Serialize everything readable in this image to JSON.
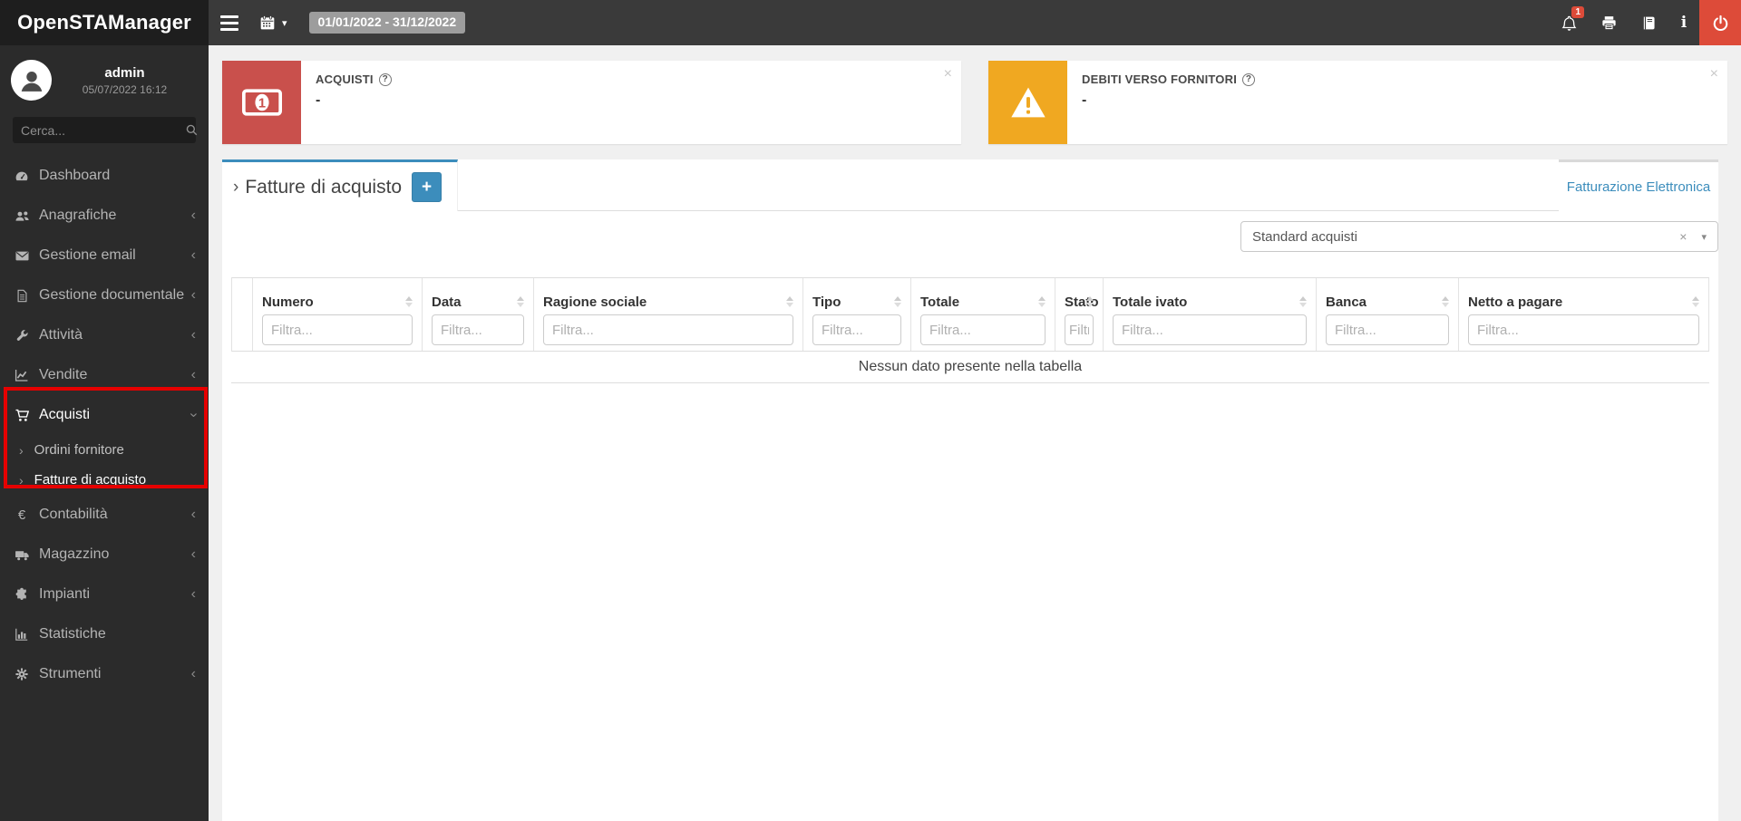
{
  "app": {
    "name": "OpenSTAManager"
  },
  "navbar": {
    "date_range": "01/01/2022 - 31/12/2022",
    "notification_count": "1"
  },
  "sidebar": {
    "user_name": "admin",
    "user_datetime": "05/07/2022 16:12",
    "search_placeholder": "Cerca...",
    "items": [
      {
        "label": "Dashboard"
      },
      {
        "label": "Anagrafiche"
      },
      {
        "label": "Gestione email"
      },
      {
        "label": "Gestione documentale"
      },
      {
        "label": "Attività"
      },
      {
        "label": "Vendite"
      },
      {
        "label": "Acquisti"
      },
      {
        "label": "Contabilità"
      },
      {
        "label": "Magazzino"
      },
      {
        "label": "Impianti"
      },
      {
        "label": "Statistiche"
      },
      {
        "label": "Strumenti"
      }
    ],
    "acquisti_children": [
      {
        "label": "Ordini fornitore"
      },
      {
        "label": "Fatture di acquisto"
      }
    ]
  },
  "widgets": [
    {
      "title": "ACQUISTI",
      "value": "-",
      "accent": "#c9504c"
    },
    {
      "title": "DEBITI VERSO FORNITORI",
      "value": "-",
      "accent": "#f0a821"
    }
  ],
  "tabs": {
    "active_title": "Fatture di acquisto",
    "add_label": "+",
    "right_link": "Fatturazione Elettronica"
  },
  "toolbar": {
    "view_select_value": "Standard acquisti"
  },
  "table": {
    "filter_placeholder": "Filtra...",
    "empty_message": "Nessun dato presente nella tabella",
    "columns": [
      {
        "label": "Numero"
      },
      {
        "label": "Data"
      },
      {
        "label": "Ragione sociale"
      },
      {
        "label": "Tipo"
      },
      {
        "label": "Totale"
      },
      {
        "label": "Stato"
      },
      {
        "label": "Totale ivato"
      },
      {
        "label": "Banca"
      },
      {
        "label": "Netto a pagare"
      }
    ]
  },
  "glyphs": {
    "help": "?",
    "close": "×",
    "clear": "×",
    "caret_down": "▾",
    "chevron_collapsed": "‹",
    "chevron_sub": "›",
    "tab_chevron": "›",
    "info": "i"
  },
  "colors": {
    "accent_blue": "#3c8dbc",
    "danger_red": "#dd4b39",
    "annotation_red": "#e60000"
  }
}
